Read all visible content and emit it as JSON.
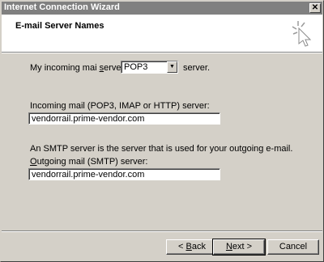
{
  "window": {
    "title": "Internet Connection Wizard",
    "close_glyph": "✕"
  },
  "header": {
    "heading": "E-mail Server Names",
    "icon": "wizard-sparkle-icon"
  },
  "incoming_type": {
    "label_pre": "My incoming mai ",
    "label_access": "s",
    "label_post": "erver is a",
    "selected": "POP3",
    "suffix": "server."
  },
  "incoming_server": {
    "label": "Incoming mail (POP3, IMAP or HTTP) server:",
    "value": "vendorrail.prime-vendor.com"
  },
  "smtp_note": "An SMTP server is the server that is used for your outgoing e-mail.",
  "outgoing_server": {
    "label_access": "O",
    "label_rest": "utgoing mail (SMTP) server:",
    "value": "vendorrail.prime-vendor.com"
  },
  "buttons": {
    "back_prefix": "< ",
    "back_access": "B",
    "back_rest": "ack",
    "next_access": "N",
    "next_rest": "ext >",
    "cancel": "Cancel"
  }
}
